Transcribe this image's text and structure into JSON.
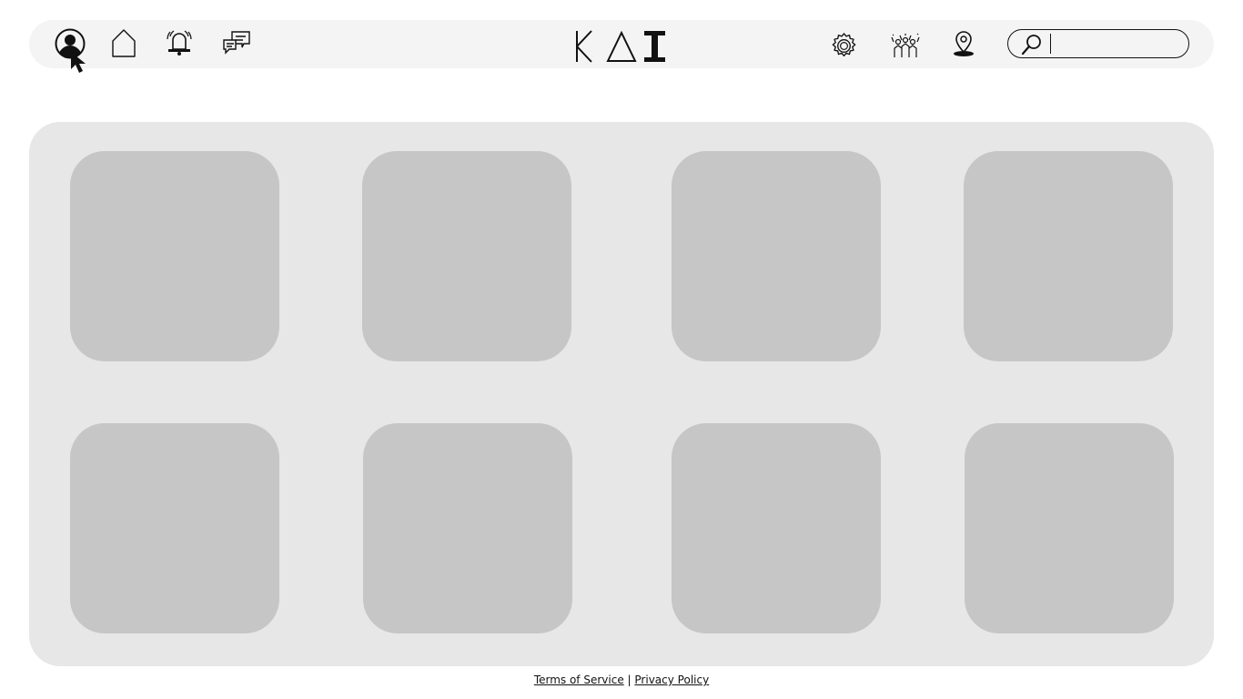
{
  "header": {
    "logo_text": "KAI",
    "left_icons": [
      "profile-icon",
      "home-icon",
      "notification-bell-icon",
      "messages-icon"
    ],
    "right_icons": [
      "gear-icon",
      "community-icon",
      "location-pin-icon"
    ],
    "search": {
      "placeholder": "",
      "value": ""
    }
  },
  "grid": {
    "tiles": [
      "",
      "",
      "",
      "",
      "",
      "",
      "",
      ""
    ]
  },
  "footer": {
    "terms_label": "Terms of Service",
    "separator": "|",
    "privacy_label": "Privacy Policy"
  },
  "colors": {
    "topbar": "#f4f4f4",
    "panel": "#e7e7e7",
    "tile": "#c6c6c6",
    "ink": "#111111"
  }
}
